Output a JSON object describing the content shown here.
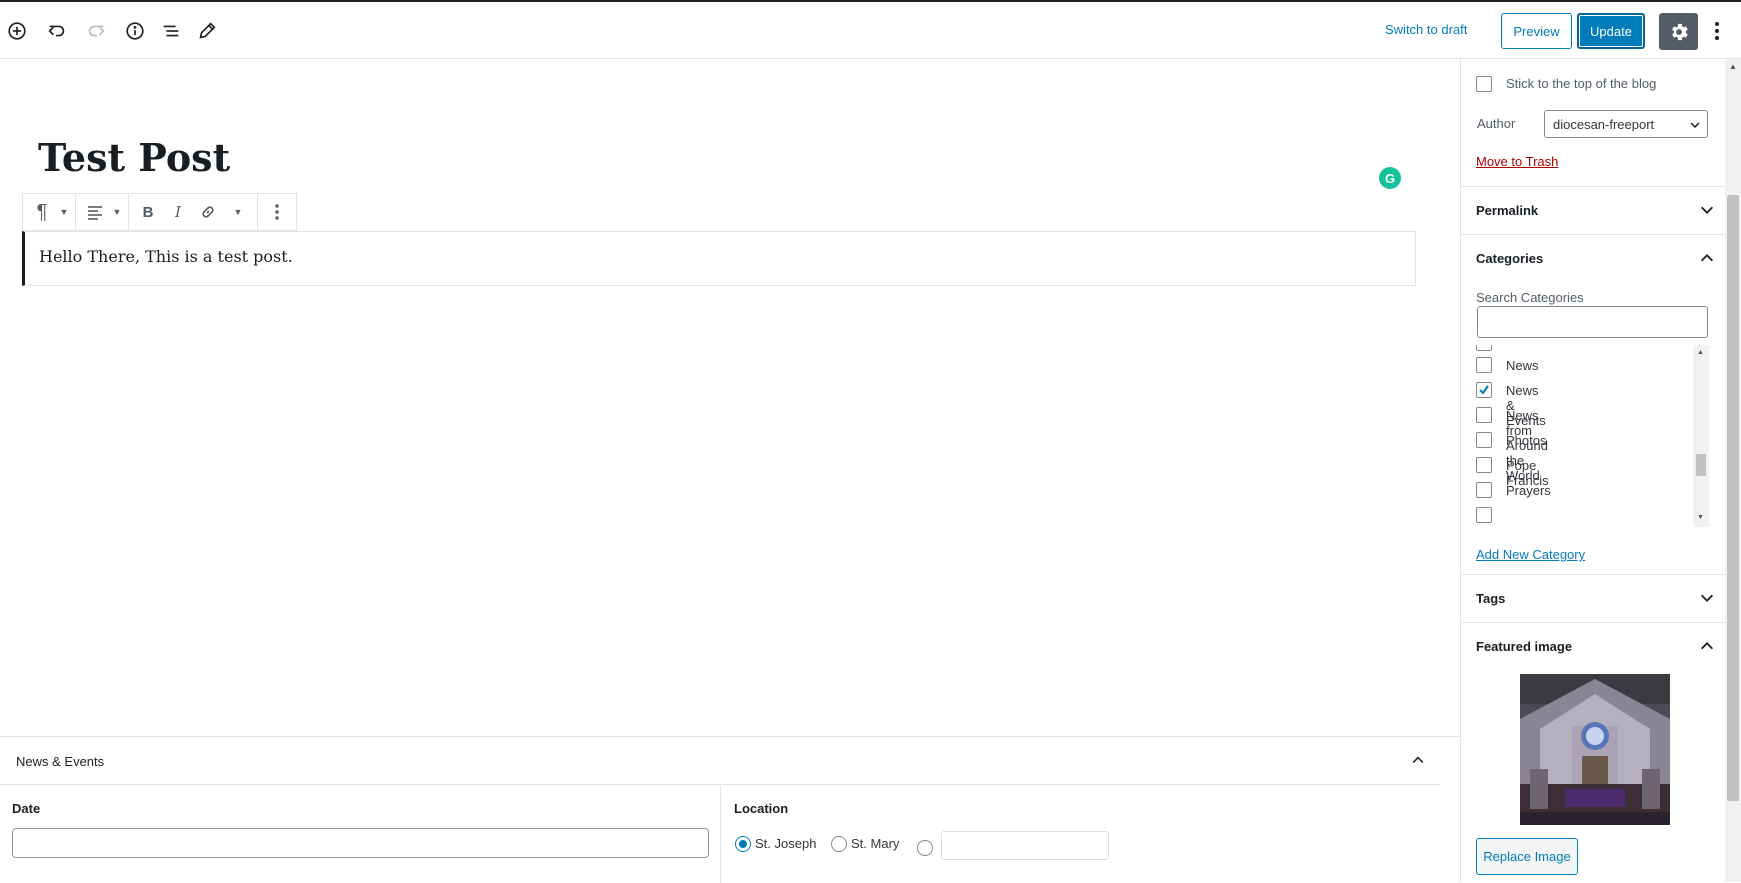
{
  "header": {
    "switch_to_draft": "Switch to draft",
    "preview": "Preview",
    "update": "Update"
  },
  "editor": {
    "post_title": "Test Post",
    "paragraph_text": "Hello There, This is a test post.",
    "grammarly_glyph": "G"
  },
  "metabox": {
    "title": "News & Events",
    "date_label": "Date",
    "date_value": "",
    "location_label": "Location",
    "location_options": [
      "St. Joseph",
      "St. Mary"
    ],
    "location_selected": "St. Joseph"
  },
  "sidebar": {
    "stick_to_top": "Stick to the top of the blog",
    "author_label": "Author",
    "author_value": "diocesan-freeport",
    "move_to_trash": "Move to Trash",
    "permalink": "Permalink",
    "categories": {
      "title": "Categories",
      "search_label": "Search Categories",
      "items": [
        {
          "label": "News",
          "checked": false
        },
        {
          "label": "News & Events",
          "checked": true
        },
        {
          "label": "News from Around the World",
          "checked": false
        },
        {
          "label": "Photos",
          "checked": false
        },
        {
          "label": "Pope Francis",
          "checked": false
        },
        {
          "label": "Prayers",
          "checked": false
        }
      ],
      "add_new": "Add New Category"
    },
    "tags": "Tags",
    "featured_image": {
      "title": "Featured image",
      "replace": "Replace Image"
    }
  },
  "colors": {
    "accent": "#007cba",
    "danger": "#a00",
    "grammarly": "#15c39a",
    "settings_bg": "#555d66"
  }
}
